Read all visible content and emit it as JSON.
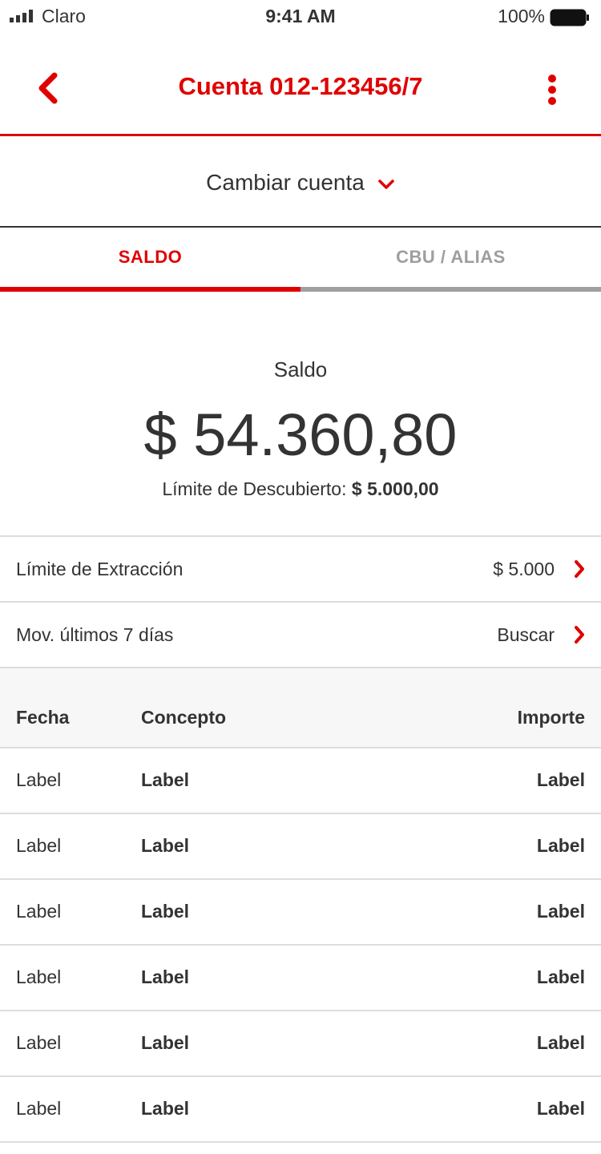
{
  "status_bar": {
    "carrier": "Claro",
    "time": "9:41 AM",
    "battery": "100%"
  },
  "nav": {
    "title": "Cuenta 012-123456/7",
    "back_icon": "chevron-left-icon",
    "more_icon": "more-vertical-icon"
  },
  "account_switch": {
    "label": "Cambiar cuenta",
    "icon": "chevron-down-icon"
  },
  "tabs": [
    {
      "label": "SALDO",
      "active": true
    },
    {
      "label": "CBU / ALIAS",
      "active": false
    }
  ],
  "balance": {
    "title": "Saldo",
    "amount": "$ 54.360,80",
    "overdraft_label": "Límite de Descubierto:",
    "overdraft_value": "$ 5.000,00"
  },
  "rows": [
    {
      "label": "Límite de Extracción",
      "value": "$ 5.000"
    },
    {
      "label": "Mov. últimos 7 días",
      "value": "Buscar"
    }
  ],
  "table": {
    "headers": {
      "fecha": "Fecha",
      "concepto": "Concepto",
      "importe": "Importe"
    },
    "rows": [
      {
        "fecha": "Label",
        "concepto": "Label",
        "importe": "Label"
      },
      {
        "fecha": "Label",
        "concepto": "Label",
        "importe": "Label"
      },
      {
        "fecha": "Label",
        "concepto": "Label",
        "importe": "Label"
      },
      {
        "fecha": "Label",
        "concepto": "Label",
        "importe": "Label"
      },
      {
        "fecha": "Label",
        "concepto": "Label",
        "importe": "Label"
      },
      {
        "fecha": "Label",
        "concepto": "Label",
        "importe": "Label"
      }
    ]
  },
  "colors": {
    "accent": "#e00000",
    "text": "#333333",
    "muted": "#9e9e9e",
    "divider": "#dddddd",
    "table_header_bg": "#f7f7f7"
  }
}
